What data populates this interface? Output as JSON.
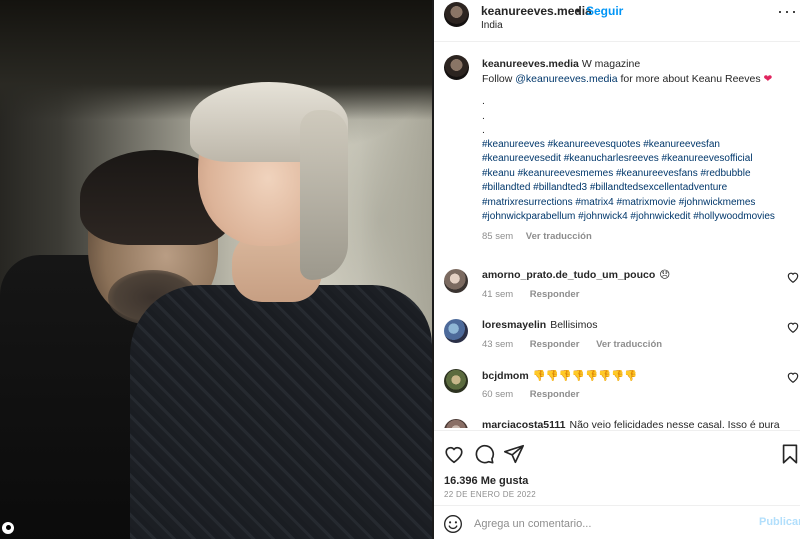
{
  "post": {
    "username": "keanureeves.media",
    "follow_label": "Seguir",
    "separator": "•",
    "location": "India"
  },
  "caption": {
    "username": "keanureeves.media",
    "title": "W magazine",
    "follow_prefix": "Follow",
    "mention": "@keanureeves.media",
    "follow_suffix": "for more about Keanu Reeves",
    "heart": "❤",
    "dots": [
      ".",
      ".",
      "."
    ],
    "hashtags": "#keanureeves #keanureevesquotes #keanureevesfan #keanureevesedit #keanucharlesreeves #keanureevesofficial #keanu #keanureevesmemes #keanureevesfans #redbubble #billandted #billandted3 #billandtedsexcellentadventure #matrixresurrections #matrix4 #matrixmovie #johnwickmemes #johnwickparabellum #johnwick4 #johnwickedit #hollywoodmovies",
    "time": "85 sem",
    "translate_label": "Ver traducción"
  },
  "comments": [
    {
      "username": "amorno_prato.de_tudo_um_pouco",
      "text": "😞",
      "time": "41 sem",
      "reply_label": "Responder",
      "translate_label": ""
    },
    {
      "username": "loresmayelin",
      "text": "Bellisimos",
      "time": "43 sem",
      "reply_label": "Responder",
      "translate_label": "Ver traducción"
    },
    {
      "username": "bcjdmom",
      "text": "👎👎👎👎👎👎👎👎",
      "time": "60 sem",
      "reply_label": "Responder",
      "translate_label": ""
    },
    {
      "username": "marciacosta5111",
      "text": "Não vejo felicidades nesse casal. Isso é pura"
    }
  ],
  "actions": {
    "likes": "16.396 Me gusta",
    "date": "22 DE ENERO DE 2022"
  },
  "add_comment": {
    "placeholder": "Agrega un comentario...",
    "publish_label": "Publicar"
  },
  "colors": {
    "accent": "#0095f6",
    "link": "#00376b",
    "muted": "#8e8e8e",
    "publish_disabled": "#b2dffc"
  }
}
